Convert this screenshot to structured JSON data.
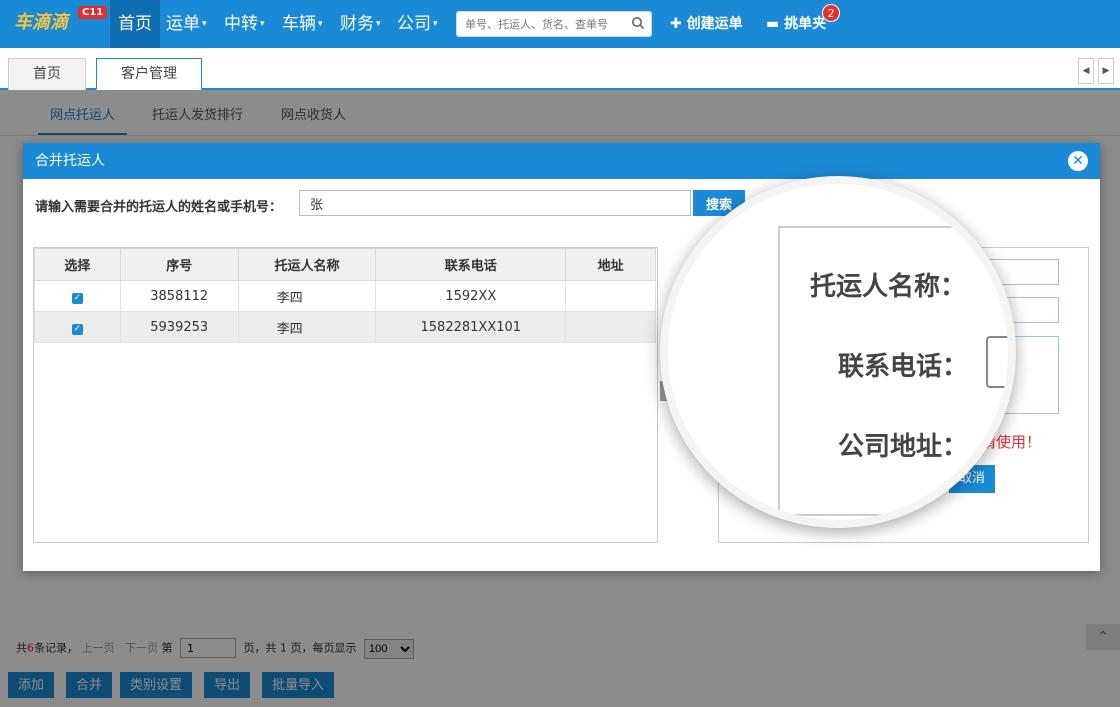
{
  "topbar": {
    "logo_text": "车滴滴",
    "logo_badge": "C11",
    "nav": [
      "首页",
      "运单",
      "中转",
      "车辆",
      "财务",
      "公司"
    ],
    "search_placeholder": "单号、托运人、货名、查单号",
    "create_label": "创建运单",
    "folder_label": "挑单夹",
    "folder_count": "2"
  },
  "tabs": [
    "首页",
    "客户管理"
  ],
  "subtabs": [
    "网点托运人",
    "托运人发货排行",
    "网点收货人"
  ],
  "pager": {
    "total_prefix": "共",
    "total_count": "6",
    "total_suffix": "条记录，",
    "prev": "上一页",
    "next": "下一页",
    "page_prefix": "第",
    "page_value": "1",
    "page_suffix": "页，共 1 页，每页显示",
    "per_page": "100"
  },
  "bottom_buttons": [
    "添加",
    "合并",
    "类别设置",
    "导出",
    "批量导入"
  ],
  "modal": {
    "title": "合并托运人",
    "search_label": "请输入需要合并的托运人的姓名或手机号：",
    "search_value": "张",
    "search_button": "搜索",
    "columns": [
      "选择",
      "序号",
      "托运人名称",
      "联系电话",
      "地址"
    ],
    "rows": [
      {
        "seq": "3858112",
        "name": "李四",
        "phone": "1592XX",
        "address": ""
      },
      {
        "seq": "5939253",
        "name": "李四",
        "phone": "1582281XX101",
        "address": ""
      }
    ],
    "warning": "请使用！",
    "cancel_button": "取消"
  },
  "magnifier": {
    "labels": [
      "托运人名称：",
      "联系电话：",
      "公司地址："
    ]
  },
  "colors": {
    "primary": "#1b8ad6",
    "danger": "#e23030"
  }
}
